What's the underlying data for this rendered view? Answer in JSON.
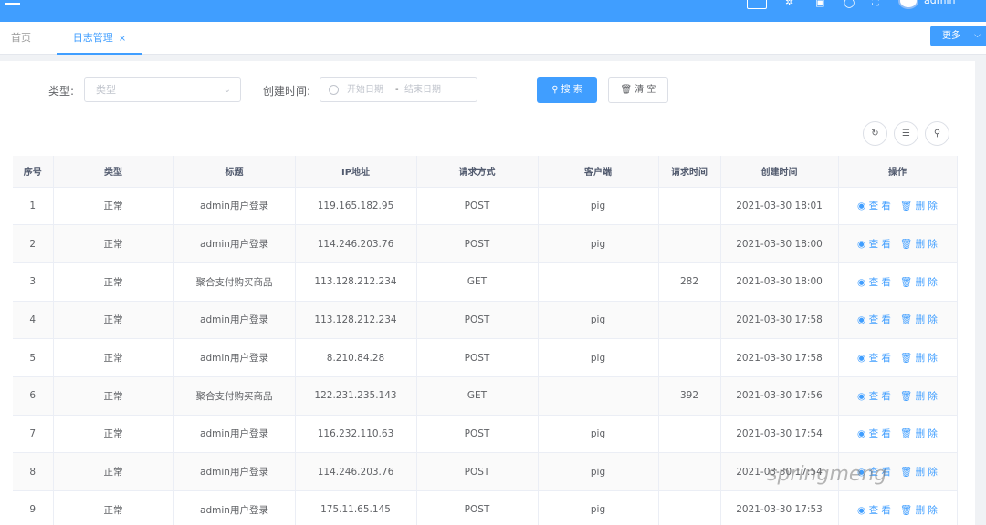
{
  "header": {
    "user_name": "admin"
  },
  "tabs": {
    "home": "首页",
    "active": "日志管理",
    "close_icon": "×",
    "more": "更多"
  },
  "filters": {
    "type_label": "类型:",
    "type_placeholder": "类型",
    "date_label": "创建时间:",
    "date_start_placeholder": "开始日期",
    "date_separator": "-",
    "date_end_placeholder": "结束日期",
    "search_button": "搜 索",
    "clear_button": "清 空"
  },
  "table": {
    "headers": [
      "序号",
      "类型",
      "标题",
      "IP地址",
      "请求方式",
      "客户端",
      "请求时间",
      "创建时间",
      "操作"
    ],
    "view_label": "查 看",
    "delete_label": "删 除",
    "rows": [
      [
        "1",
        "正常",
        "admin用户登录",
        "119.165.182.95",
        "POST",
        "pig",
        "",
        "2021-03-30 18:01"
      ],
      [
        "2",
        "正常",
        "admin用户登录",
        "114.246.203.76",
        "POST",
        "pig",
        "",
        "2021-03-30 18:00"
      ],
      [
        "3",
        "正常",
        "聚合支付购买商品",
        "113.128.212.234",
        "GET",
        "",
        "282",
        "2021-03-30 18:00"
      ],
      [
        "4",
        "正常",
        "admin用户登录",
        "113.128.212.234",
        "POST",
        "pig",
        "",
        "2021-03-30 17:58"
      ],
      [
        "5",
        "正常",
        "admin用户登录",
        "8.210.84.28",
        "POST",
        "pig",
        "",
        "2021-03-30 17:58"
      ],
      [
        "6",
        "正常",
        "聚合支付购买商品",
        "122.231.235.143",
        "GET",
        "",
        "392",
        "2021-03-30 17:56"
      ],
      [
        "7",
        "正常",
        "admin用户登录",
        "116.232.110.63",
        "POST",
        "pig",
        "",
        "2021-03-30 17:54"
      ],
      [
        "8",
        "正常",
        "admin用户登录",
        "114.246.203.76",
        "POST",
        "pig",
        "",
        "2021-03-30 17:54"
      ],
      [
        "9",
        "正常",
        "admin用户登录",
        "175.11.65.145",
        "POST",
        "pig",
        "",
        "2021-03-30 17:53"
      ]
    ]
  },
  "watermark": "springmeng"
}
